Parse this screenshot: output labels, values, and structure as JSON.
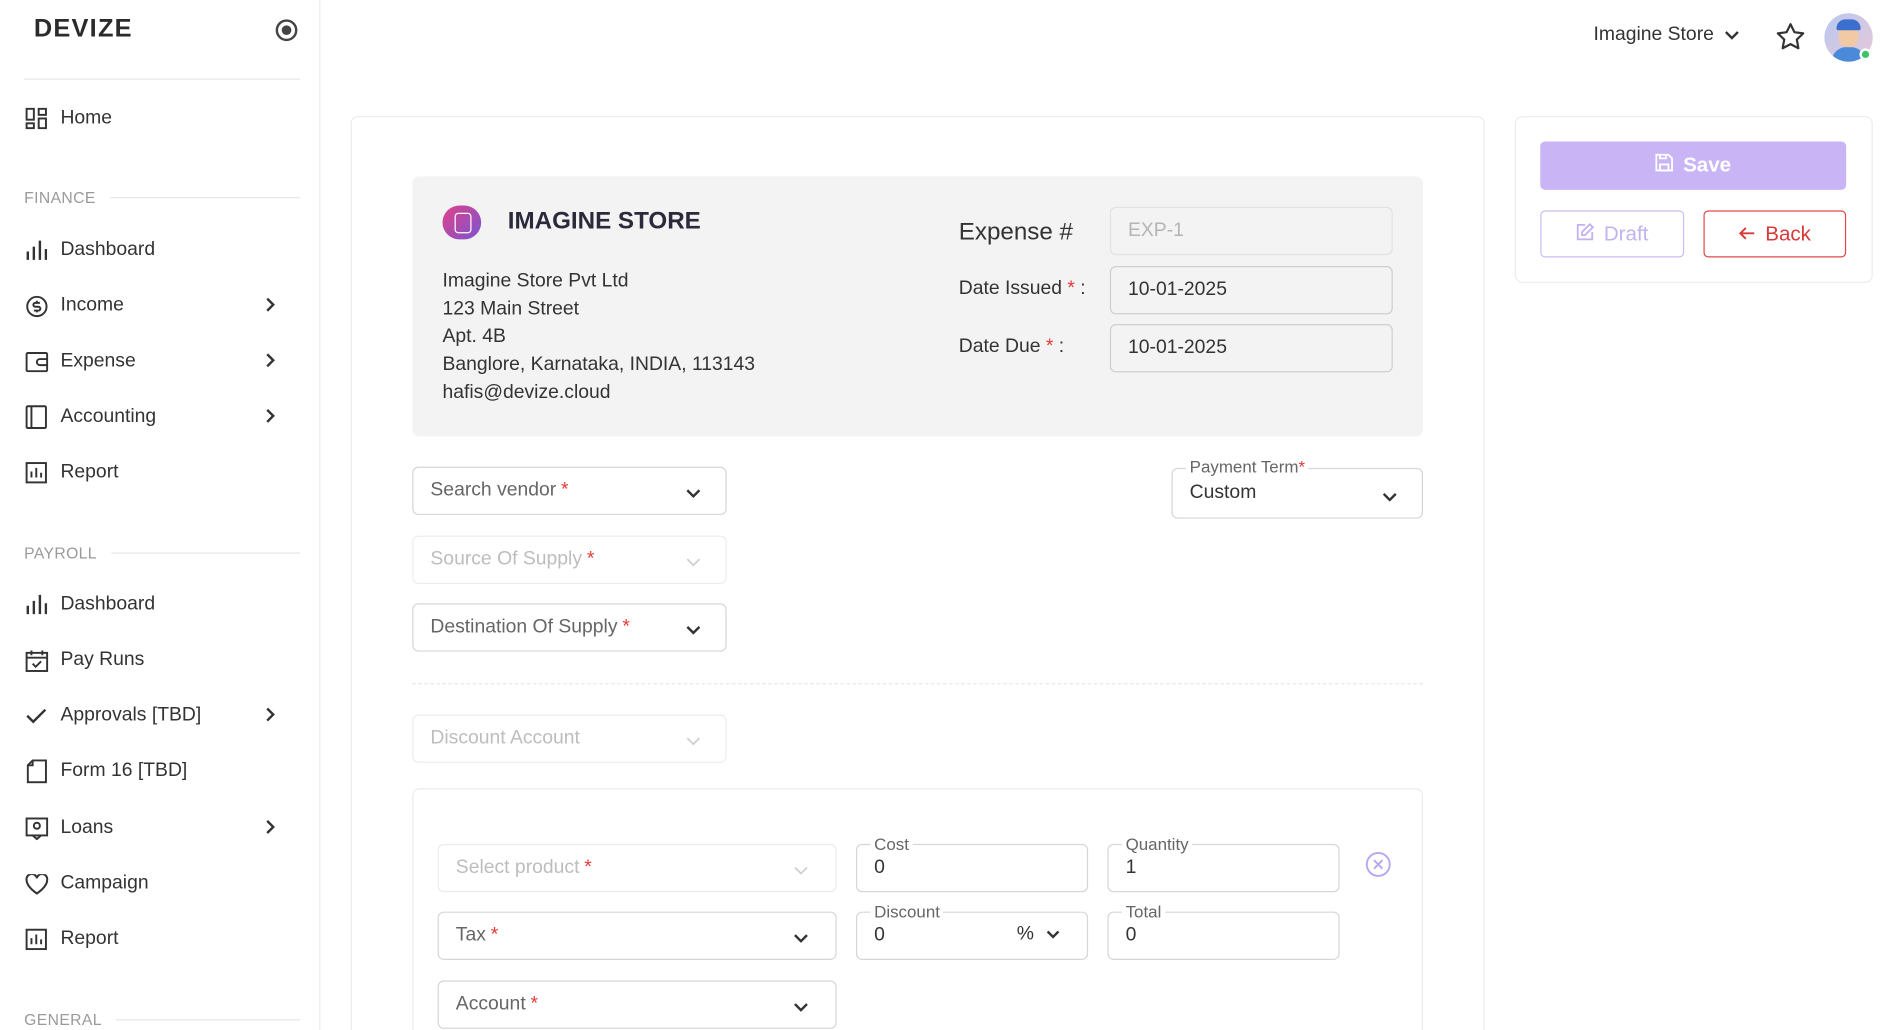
{
  "sidebar": {
    "brand": "DEVIZE",
    "home": "Home",
    "sections": {
      "finance": "FINANCE",
      "payroll": "PAYROLL",
      "general": "GENERAL"
    },
    "finance_items": [
      "Dashboard",
      "Income",
      "Expense",
      "Accounting",
      "Report"
    ],
    "payroll_items": [
      "Dashboard",
      "Pay Runs",
      "Approvals [TBD]",
      "Form 16 [TBD]",
      "Loans",
      "Campaign",
      "Report"
    ]
  },
  "header": {
    "store": "Imagine Store"
  },
  "company": {
    "name": "IMAGINE STORE",
    "address": [
      "Imagine Store Pvt Ltd",
      "123 Main Street",
      "Apt. 4B",
      "Banglore, Karnataka, INDIA, 113143",
      "hafis@devize.cloud"
    ]
  },
  "expense": {
    "number_label": "Expense #",
    "number_value": "EXP-1",
    "date_issued_label": "Date Issued",
    "date_issued_value": "10-01-2025",
    "date_due_label": "Date Due",
    "date_due_value": "10-01-2025",
    "colon": ":",
    "required_mark": "*"
  },
  "form": {
    "search_vendor": "Search vendor",
    "source_of_supply": "Source Of Supply",
    "destination_of_supply": "Destination Of Supply",
    "payment_term_label": "Payment Term",
    "payment_term_value": "Custom",
    "discount_account": "Discount Account"
  },
  "line_item": {
    "select_product": "Select product",
    "tax": "Tax",
    "account": "Account",
    "cost_label": "Cost",
    "cost_value": "0",
    "quantity_label": "Quantity",
    "quantity_value": "1",
    "discount_label": "Discount",
    "discount_value": "0",
    "discount_unit": "%",
    "total_label": "Total",
    "total_value": "0"
  },
  "actions": {
    "save": "Save",
    "draft": "Draft",
    "back": "Back"
  },
  "colors": {
    "save_bg": "#c9b5f5",
    "back_border": "#e04848",
    "required": "#e53935"
  }
}
